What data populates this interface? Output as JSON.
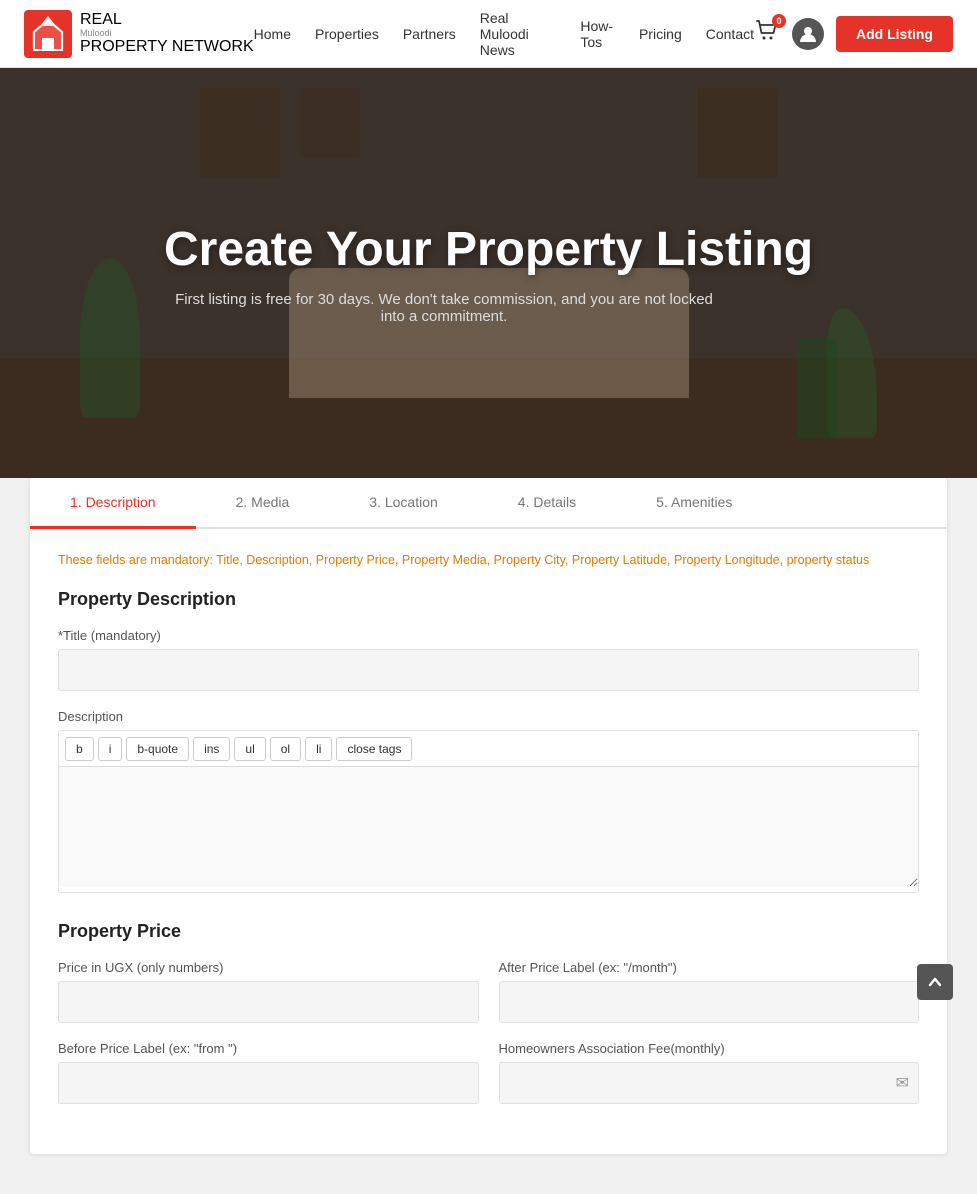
{
  "header": {
    "logo": {
      "real_label": "REAL",
      "muloodi_label": "Muloodi",
      "network_label": "PROPERTY NETWORK"
    },
    "nav": {
      "items": [
        {
          "label": "Home",
          "href": "#"
        },
        {
          "label": "Properties",
          "href": "#"
        },
        {
          "label": "Partners",
          "href": "#"
        },
        {
          "label": "Real Muloodi News",
          "href": "#"
        },
        {
          "label": "How-Tos",
          "href": "#"
        },
        {
          "label": "Pricing",
          "href": "#"
        },
        {
          "label": "Contact",
          "href": "#"
        }
      ]
    },
    "cart_badge": "0",
    "add_listing_label": "Add Listing"
  },
  "hero": {
    "title": "Create Your Property Listing",
    "subtitle": "First listing is free for 30 days. We don't take commission, and you are not locked into a commitment."
  },
  "tabs": [
    {
      "label": "1. Description",
      "active": true
    },
    {
      "label": "2. Media",
      "active": false
    },
    {
      "label": "3. Location",
      "active": false
    },
    {
      "label": "4. Details",
      "active": false
    },
    {
      "label": "5. Amenities",
      "active": false
    }
  ],
  "form": {
    "mandatory_note": "These fields are mandatory: Title, Description, Property Price, Property Media, Property City, Property Latitude, Property Longitude, property status",
    "property_description": {
      "section_title": "Property Description",
      "title_label": "*Title (mandatory)",
      "title_placeholder": "",
      "description_label": "Description",
      "editor_buttons": [
        "b",
        "i",
        "b-quote",
        "ins",
        "ul",
        "ol",
        "li",
        "close tags"
      ]
    },
    "property_price": {
      "section_title": "Property Price",
      "price_label": "Price in UGX (only numbers)",
      "price_placeholder": "",
      "after_price_label": "After Price Label (ex: \"/month\")",
      "after_price_placeholder": "",
      "before_price_label": "Before Price Label (ex: \"from \")",
      "before_price_placeholder": "",
      "hoa_label": "Homeowners Association Fee(monthly)",
      "hoa_placeholder": ""
    }
  }
}
